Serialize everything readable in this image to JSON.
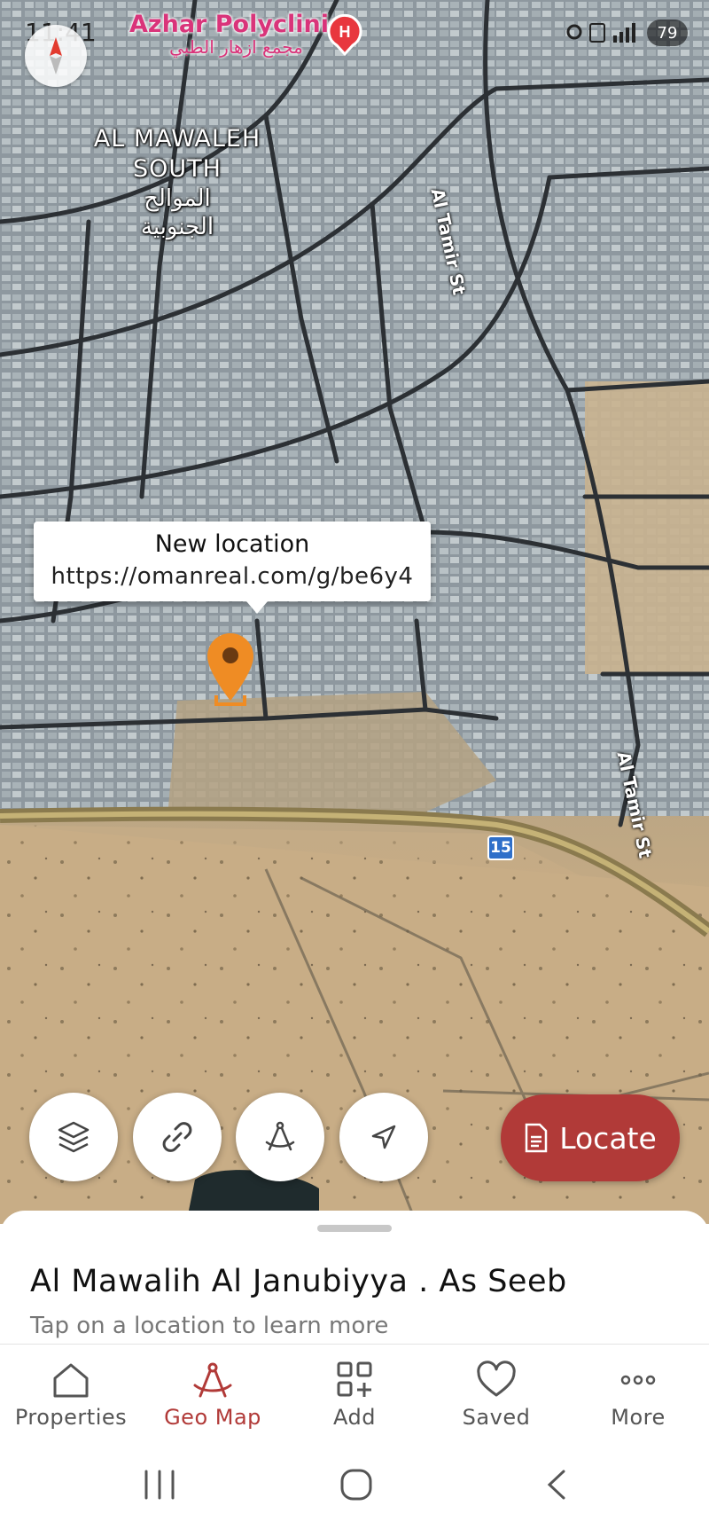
{
  "status_bar": {
    "time": "11:41",
    "battery": "79"
  },
  "map": {
    "poi": {
      "name": "Azhar Polyclinic",
      "name_ar": "مجمع ازهار الطبي"
    },
    "area_label": {
      "line1": "AL MAWALEH",
      "line2": "SOUTH",
      "line3": "الموالح",
      "line4": "الجنوبية"
    },
    "streets": [
      "Al Tamir St",
      "Al Tamir St"
    ],
    "route_number": "15",
    "popup": {
      "title": "New location",
      "link": "https://omanreal.com/g/be6y4"
    }
  },
  "actions": {
    "locate_label": "Locate"
  },
  "sheet": {
    "title": "Al Mawalih Al Janubiyya . As Seeb",
    "subtitle": "Tap on a location to learn more"
  },
  "nav": {
    "items": [
      {
        "label": "Properties",
        "icon": "home-icon"
      },
      {
        "label": "Geo Map",
        "icon": "compass-draw-icon"
      },
      {
        "label": "Add",
        "icon": "add-grid-icon"
      },
      {
        "label": "Saved",
        "icon": "heart-icon"
      },
      {
        "label": "More",
        "icon": "more-icon"
      }
    ],
    "active": "Geo Map"
  },
  "colors": {
    "accent": "#b13a38",
    "pin": "#ef8c24",
    "poi": "#d9347a"
  }
}
